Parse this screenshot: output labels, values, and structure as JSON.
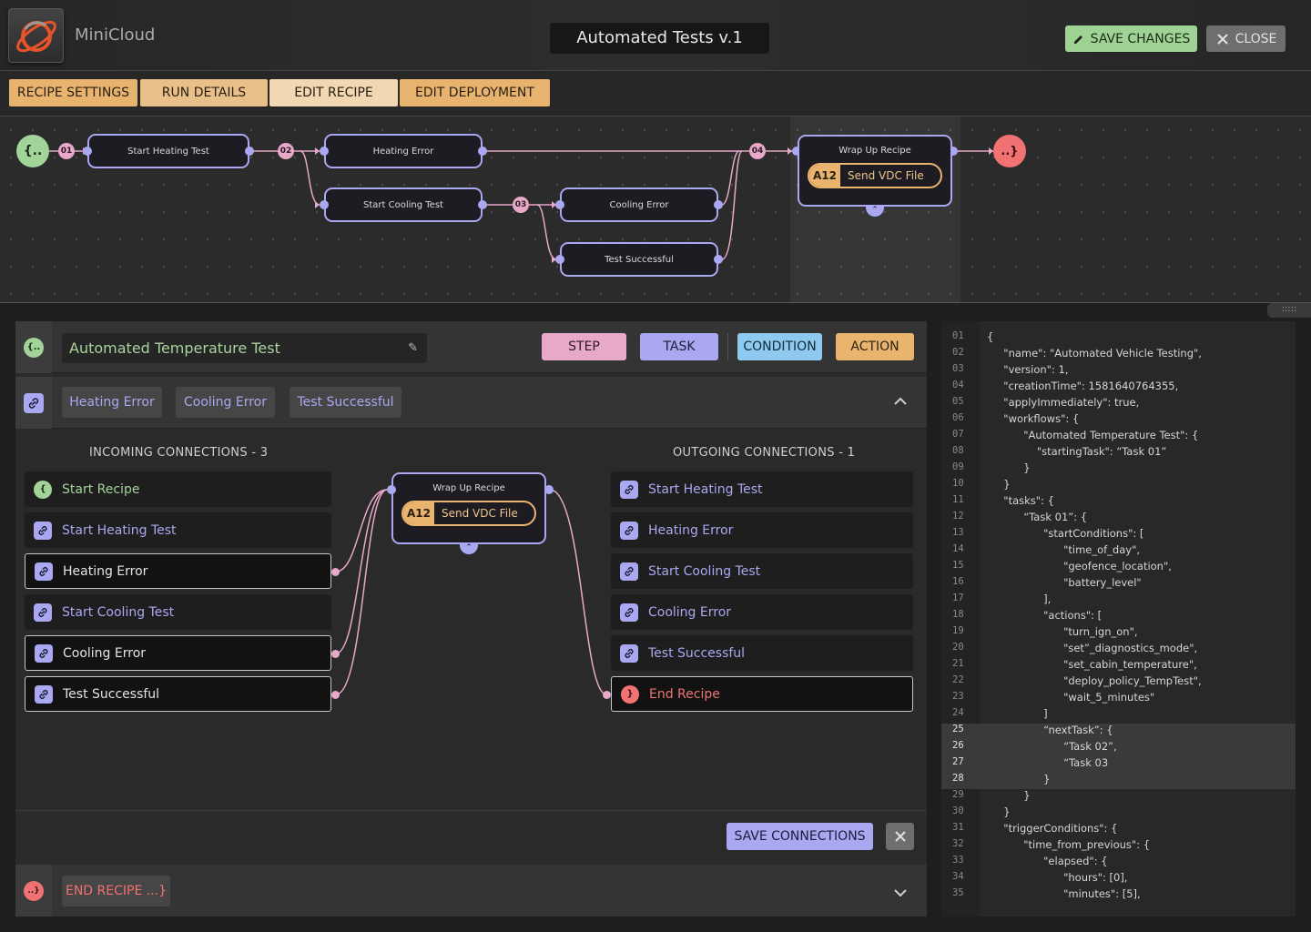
{
  "header": {
    "app_name": "MiniCloud",
    "title": "Automated Tests v.1",
    "save_label": "SAVE CHANGES",
    "close_label": "CLOSE"
  },
  "tabs": [
    {
      "label": "RECIPE SETTINGS"
    },
    {
      "label": "RUN DETAILS"
    },
    {
      "label": "EDIT RECIPE"
    },
    {
      "label": "EDIT DEPLOYMENT"
    }
  ],
  "flow": {
    "start_label": "{..",
    "end_label": "..}",
    "nodes": {
      "start_heating": "Start Heating Test",
      "heating_error": "Heating Error",
      "start_cooling": "Start Cooling Test",
      "cooling_error": "Cooling Error",
      "test_successful": "Test Successful"
    },
    "numbers": [
      "01",
      "02",
      "03",
      "04"
    ],
    "wrap": {
      "title": "Wrap Up Recipe",
      "action_code": "A12",
      "action_label": "Send VDC File"
    }
  },
  "editor": {
    "start_icon": "{..",
    "recipe_name": "Automated Temperature Test",
    "types": [
      "STEP",
      "TASK",
      "CONDITION",
      "ACTION"
    ],
    "linked": [
      "Heating Error",
      "Cooling Error",
      "Test Successful"
    ],
    "incoming_title": "INCOMING CONNECTIONS - 3",
    "outgoing_title": "OUTGOING CONNECTIONS - 1",
    "incoming": [
      {
        "label": "Start Recipe",
        "icon": "{"
      },
      {
        "label": "Start Heating Test"
      },
      {
        "label": "Heating Error"
      },
      {
        "label": "Start Cooling Test"
      },
      {
        "label": "Cooling Error"
      },
      {
        "label": "Test Successful"
      }
    ],
    "outgoing": [
      {
        "label": "Start Heating Test"
      },
      {
        "label": "Heating Error"
      },
      {
        "label": "Start Cooling Test"
      },
      {
        "label": "Cooling Error"
      },
      {
        "label": "Test Successful"
      },
      {
        "label": "End Recipe",
        "icon": "}"
      }
    ],
    "center_node": {
      "title": "Wrap Up Recipe",
      "action_code": "A12",
      "action_label": "Send VDC File"
    },
    "save_connections": "SAVE CONNECTIONS",
    "end_icon": "..}",
    "end_label": "END RECIPE ...}"
  },
  "code": {
    "lines": [
      {
        "n": "01",
        "t": "{"
      },
      {
        "n": "02",
        "t": "     \"name\": \"Automated Vehicle Testing\","
      },
      {
        "n": "03",
        "t": "     \"version\": 1,"
      },
      {
        "n": "04",
        "t": "     \"creationTime\": 1581640764355,"
      },
      {
        "n": "05",
        "t": "     \"applyImmediately\": true,"
      },
      {
        "n": "06",
        "t": "     \"workflows\": {"
      },
      {
        "n": "07",
        "t": "           \"Automated Temperature Test\": {"
      },
      {
        "n": "08",
        "t": "               \"startingTask\": “Task 01”"
      },
      {
        "n": "09",
        "t": "           }"
      },
      {
        "n": "10",
        "t": "     }"
      },
      {
        "n": "11",
        "t": "     \"tasks\": {"
      },
      {
        "n": "12",
        "t": "           “Task 01”: {"
      },
      {
        "n": "13",
        "t": "                 \"startConditions\": ["
      },
      {
        "n": "14",
        "t": "                       \"time_of_day\","
      },
      {
        "n": "15",
        "t": "                       \"geofence_location\","
      },
      {
        "n": "16",
        "t": "                       \"battery_level\""
      },
      {
        "n": "17",
        "t": "                 ],"
      },
      {
        "n": "18",
        "t": "                 \"actions\": ["
      },
      {
        "n": "19",
        "t": "                       \"turn_ign_on\","
      },
      {
        "n": "20",
        "t": "                       \"set”_diagnostics_mode\","
      },
      {
        "n": "21",
        "t": "                       \"set_cabin_temperature\","
      },
      {
        "n": "22",
        "t": "                       \"deploy_policy_TempTest\","
      },
      {
        "n": "23",
        "t": "                       \"wait_5_minutes\""
      },
      {
        "n": "24",
        "t": "                 ]"
      },
      {
        "n": "25",
        "t": "                 “nextTask”: {",
        "hl": true
      },
      {
        "n": "26",
        "t": "                       “Task 02”,",
        "hl": true
      },
      {
        "n": "27",
        "t": "                       “Task 03",
        "hl": true
      },
      {
        "n": "28",
        "t": "                 }",
        "hl": true
      },
      {
        "n": "29",
        "t": "           }"
      },
      {
        "n": "30",
        "t": "     }"
      },
      {
        "n": "31",
        "t": "     \"triggerConditions\": {"
      },
      {
        "n": "32",
        "t": "           \"time_from_previous\": {"
      },
      {
        "n": "33",
        "t": "                 \"elapsed\": {"
      },
      {
        "n": "34",
        "t": "                       \"hours\": [0],"
      },
      {
        "n": "35",
        "t": "                       \"minutes\": [5],"
      }
    ]
  },
  "colors": {
    "accent_green": "#a2d49a",
    "accent_purple": "#a9a8f0",
    "accent_pink": "#e8a8c8",
    "accent_orange": "#e9b46e",
    "accent_red": "#f07272",
    "accent_blue": "#8ec9ef"
  }
}
